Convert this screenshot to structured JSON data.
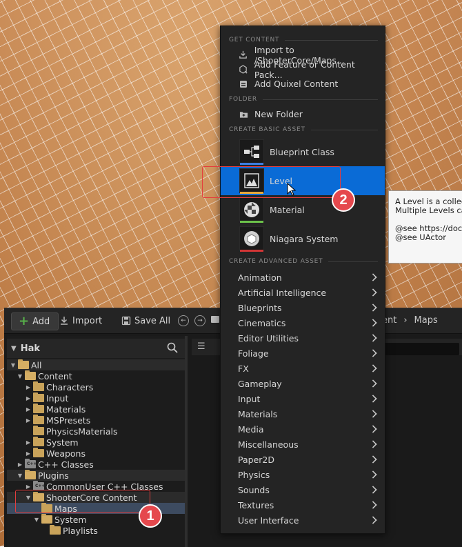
{
  "toolbar": {
    "add_label": "Add",
    "import_label": "Import",
    "save_all_label": "Save All",
    "breadcrumb_partial": "ent",
    "breadcrumb_last": "Maps"
  },
  "tree": {
    "header_title": "Hak",
    "rows": [
      {
        "label": "All"
      },
      {
        "label": "Content"
      },
      {
        "label": "Characters"
      },
      {
        "label": "Input"
      },
      {
        "label": "Materials"
      },
      {
        "label": "MSPresets"
      },
      {
        "label": "PhysicsMaterials"
      },
      {
        "label": "System"
      },
      {
        "label": "Weapons"
      },
      {
        "label": "C++ Classes"
      },
      {
        "label": "Plugins"
      },
      {
        "label": "CommonUser C++ Classes"
      },
      {
        "label": "ShooterCore Content"
      },
      {
        "label": "Maps"
      },
      {
        "label": "System"
      },
      {
        "label": "Playlists"
      }
    ]
  },
  "menu": {
    "sections": {
      "get_content": "GET CONTENT",
      "folder": "FOLDER",
      "create_basic": "CREATE BASIC ASSET",
      "create_advanced": "CREATE ADVANCED ASSET"
    },
    "get_content_items": [
      {
        "label": "Import to /ShooterCore/Maps..."
      },
      {
        "label": "Add Feature or Content Pack..."
      },
      {
        "label": "Add Quixel Content"
      }
    ],
    "folder_items": [
      {
        "label": "New Folder"
      }
    ],
    "basic_assets": [
      {
        "label": "Blueprint Class",
        "color": "#3d7ee0"
      },
      {
        "label": "Level",
        "color": "#e8a93a"
      },
      {
        "label": "Material",
        "color": "#6cc24a"
      },
      {
        "label": "Niagara System",
        "color": "#d23535"
      }
    ],
    "advanced_items": [
      {
        "label": "Animation"
      },
      {
        "label": "Artificial Intelligence"
      },
      {
        "label": "Blueprints"
      },
      {
        "label": "Cinematics"
      },
      {
        "label": "Editor Utilities"
      },
      {
        "label": "Foliage"
      },
      {
        "label": "FX"
      },
      {
        "label": "Gameplay"
      },
      {
        "label": "Input"
      },
      {
        "label": "Materials"
      },
      {
        "label": "Media"
      },
      {
        "label": "Miscellaneous"
      },
      {
        "label": "Paper2D"
      },
      {
        "label": "Physics"
      },
      {
        "label": "Sounds"
      },
      {
        "label": "Textures"
      },
      {
        "label": "User Interface"
      }
    ]
  },
  "tooltip": {
    "lines": [
      "A Level is a collect",
      "Multiple Levels ca",
      "",
      "@see https://docs",
      "@see UActor"
    ]
  },
  "annotations": {
    "badge_1": "1",
    "badge_2": "2",
    "color": "#e5484d"
  }
}
